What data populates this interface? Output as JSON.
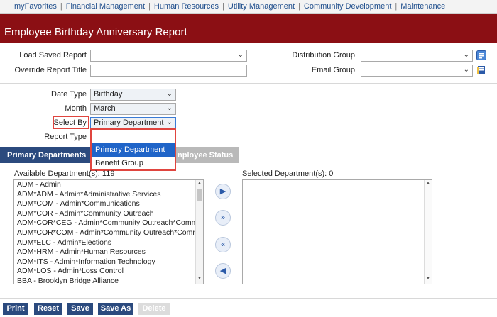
{
  "topnav": {
    "links": [
      "myFavorites",
      "Financial Management",
      "Human Resources",
      "Utility Management",
      "Community Development",
      "Maintenance"
    ]
  },
  "page": {
    "title": "Employee Birthday Anniversary Report"
  },
  "form": {
    "load_saved_report_label": "Load Saved Report",
    "load_saved_report_value": "",
    "override_title_label": "Override Report Title",
    "override_title_value": "",
    "distribution_group_label": "Distribution Group",
    "distribution_group_value": "",
    "email_group_label": "Email Group",
    "email_group_value": "",
    "date_type_label": "Date Type",
    "date_type_value": "Birthday",
    "month_label": "Month",
    "month_value": "March",
    "select_by_label": "Select By",
    "select_by_value": "Primary Department",
    "report_type_label": "Report Type"
  },
  "dropdown": {
    "options": [
      "Primary Department",
      "Benefit Group"
    ],
    "selected_index": 0
  },
  "tabs": {
    "active": "Primary Departments",
    "inactive": "nployee Status"
  },
  "available": {
    "label": "Available Department(s): 119",
    "items": [
      "ADM - Admin",
      "ADM*ADM - Admin*Administrative Services",
      "ADM*COM - Admin*Communications",
      "ADM*COR - Admin*Community Outreach",
      "ADM*COR*CEG - Admin*Community Outreach*Community",
      "ADM*COR*COM - Admin*Community Outreach*Communic",
      "ADM*ELC - Admin*Elections",
      "ADM*HRM - Admin*Human Resources",
      "ADM*ITS - Admin*Information Technology",
      "ADM*LOS - Admin*Loss Control",
      "BBA - Brooklyn Bridge Alliance"
    ]
  },
  "selected": {
    "label": "Selected Department(s): 0",
    "items": []
  },
  "buttons": {
    "print": "Print",
    "reset": "Reset",
    "save": "Save",
    "save_as": "Save As",
    "delete": "Delete"
  },
  "colors": {
    "title_bar": "#8b0f14",
    "tab_active": "#2b4a7e",
    "highlight_border": "#e0453f",
    "option_selected": "#1f64c8"
  }
}
